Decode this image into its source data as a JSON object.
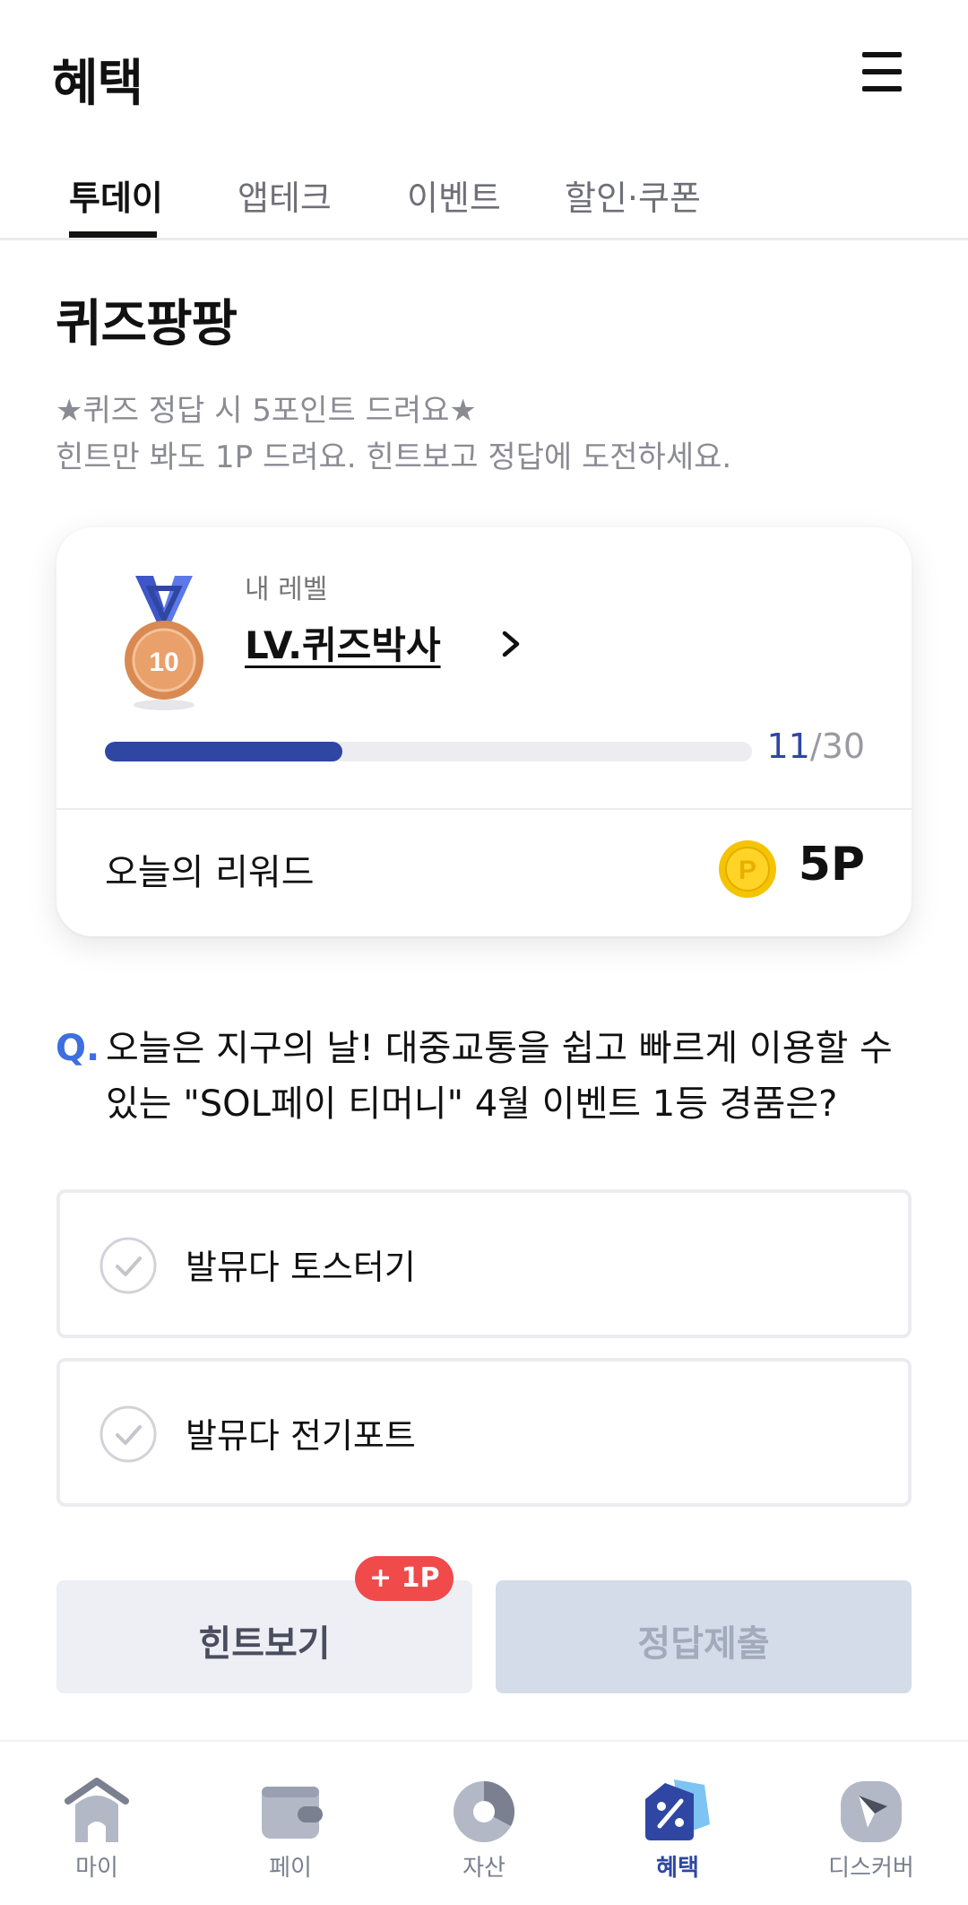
{
  "header": {
    "title": "혜택",
    "menu_icon": "hamburger-menu-icon"
  },
  "tabs": [
    {
      "label": "투데이",
      "active": true
    },
    {
      "label": "앱테크",
      "active": false
    },
    {
      "label": "이벤트",
      "active": false
    },
    {
      "label": "할인·쿠폰",
      "active": false
    }
  ],
  "quiz": {
    "title": "퀴즈팡팡",
    "desc_line1": "★퀴즈 정답 시 5포인트 드려요★",
    "desc_line2": "힌트만 봐도 1P 드려요. 힌트보고 정답에 도전하세요."
  },
  "level": {
    "caption": "내 레벨",
    "name": "LV.퀴즈박사",
    "medal_number": "10",
    "progress_current": "11",
    "progress_separator": "/",
    "progress_total": "30",
    "progress_fraction": 0.367
  },
  "reward": {
    "label": "오늘의 리워드",
    "coin_icon": "point-coin-icon",
    "coin_letter": "P",
    "value": "5P"
  },
  "question": {
    "mark": "Q.",
    "line1": "오늘은 지구의 날! 대중교통을 쉽고 빠르게 이용할 수",
    "line2": "있는 \"SOL페이 티머니\" 4월 이벤트 1등 경품은?"
  },
  "options": [
    {
      "label": "발뮤다 토스터기"
    },
    {
      "label": "발뮤다 전기포트"
    }
  ],
  "buttons": {
    "hint": "힌트보기",
    "hint_badge": "+ 1P",
    "submit": "정답제출"
  },
  "nav": [
    {
      "label": "마이",
      "icon": "home-icon",
      "active": false
    },
    {
      "label": "페이",
      "icon": "wallet-icon",
      "active": false
    },
    {
      "label": "자산",
      "icon": "pie-chart-icon",
      "active": false
    },
    {
      "label": "혜택",
      "icon": "benefit-tag-icon",
      "active": true
    },
    {
      "label": "디스커버",
      "icon": "compass-icon",
      "active": false
    }
  ],
  "colors": {
    "accent": "#2f47a3",
    "question_mark": "#3d6fe0",
    "badge": "#f04a4a",
    "coin": "#f5c400"
  }
}
